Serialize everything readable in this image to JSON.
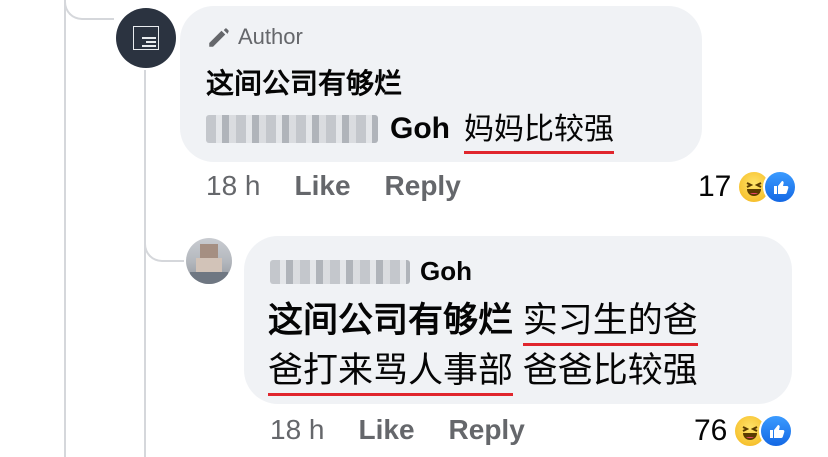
{
  "comment_1": {
    "badge_label": "Author",
    "text_line_1": "这间公司有够烂",
    "mention_surname": "Goh",
    "reply_text": "妈妈比较强",
    "timestamp": "18 h",
    "like_label": "Like",
    "reply_label": "Reply",
    "reaction_count": "17",
    "reaction_icons": [
      "haha-icon",
      "like-icon"
    ]
  },
  "comment_2": {
    "author_surname": "Goh",
    "quote_text": "这间公司有够烂",
    "underlined_text_a": "实习生的爸",
    "underlined_text_b": "爸打来骂人事部",
    "tail_text": "爸爸比较强",
    "timestamp": "18 h",
    "like_label": "Like",
    "reply_label": "Reply",
    "reaction_count": "76",
    "reaction_icons": [
      "haha-icon",
      "like-icon"
    ]
  },
  "colors": {
    "bubble": "#f0f2f5",
    "secondary_text": "#65676b",
    "underline": "#e0262d",
    "like_blue": "#1468e4",
    "haha_yellow": "#f7c331"
  }
}
